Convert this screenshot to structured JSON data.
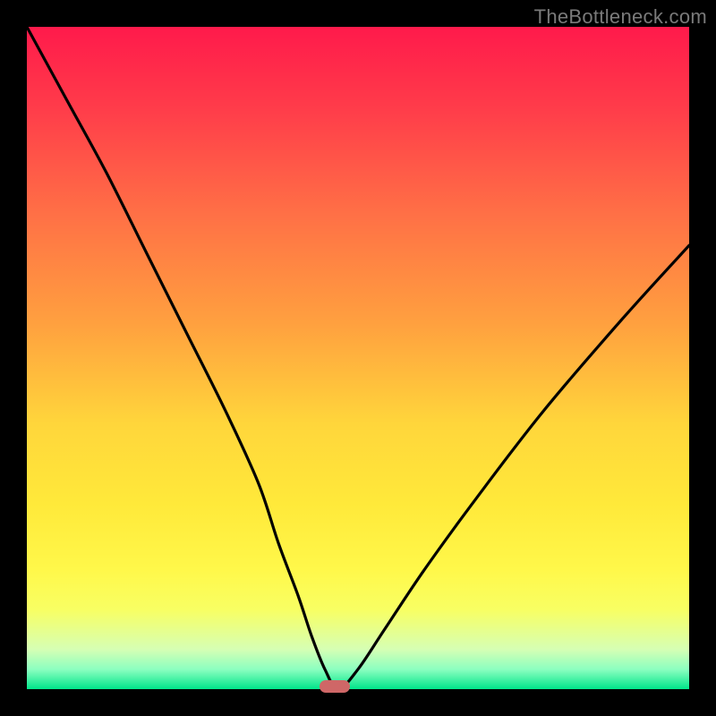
{
  "watermark": "TheBottleneck.com",
  "chart_data": {
    "type": "line",
    "title": "",
    "xlabel": "",
    "ylabel": "",
    "xlim": [
      0,
      100
    ],
    "ylim": [
      0,
      100
    ],
    "grid": false,
    "legend": false,
    "background_gradient": [
      "#ff1a4b",
      "#ff6f46",
      "#ffd63b",
      "#fff84a",
      "#00e58a"
    ],
    "series": [
      {
        "name": "bottleneck-curve",
        "x": [
          0,
          6,
          12,
          18,
          24,
          30,
          35,
          38,
          41,
          43,
          45,
          47,
          50,
          54,
          60,
          68,
          78,
          90,
          100
        ],
        "values": [
          100,
          89,
          78,
          66,
          54,
          42,
          31,
          22,
          14,
          8,
          3,
          0,
          3,
          9,
          18,
          29,
          42,
          56,
          67
        ]
      }
    ],
    "marker": {
      "x": 46.5,
      "y": 0,
      "color": "#cf6767"
    }
  }
}
